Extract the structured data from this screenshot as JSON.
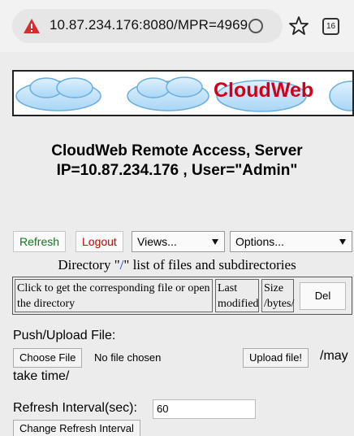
{
  "browser": {
    "url": "10.87.234.176:8080/MPR=4969",
    "tab_count": "16",
    "icons": [
      "warning-icon",
      "reload-icon",
      "star-icon",
      "tabs-icon"
    ]
  },
  "banner": {
    "brand": "CloudWeb",
    "brand_color": "#d0001a"
  },
  "header": {
    "line1": "CloudWeb Remote Access, Server",
    "line2": "IP=10.87.234.176 , User=\"Admin\""
  },
  "toolbar": {
    "refresh_label": "Refresh",
    "logout_label": "Logout",
    "views_value": "Views...",
    "options_value": "Options..."
  },
  "directory": {
    "prefix": "Directory \"",
    "path": "/",
    "suffix": "\" list of files and subdirectories",
    "columns": {
      "file": "Click to get the corresponding file or open the directory",
      "modified": "Last modified",
      "size": "Size /bytes/",
      "delete": "Del"
    }
  },
  "upload": {
    "label": "Push/Upload File:",
    "choose_label": "Choose File",
    "no_file": "No file chosen",
    "upload_label": "Upload file!",
    "note_part1": "/may",
    "note_part2": "take time/"
  },
  "refresh_interval": {
    "label": "Refresh Interval(sec):",
    "value": "60",
    "change_label": "Change Refresh Interval"
  }
}
